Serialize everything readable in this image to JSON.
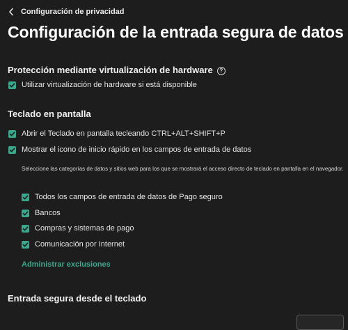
{
  "breadcrumb": {
    "back_label": "Configuración de privacidad"
  },
  "page": {
    "title": "Configuración de la entrada segura de datos"
  },
  "hardware_section": {
    "heading": "Protección mediante virtualización de hardware",
    "help_glyph": "?",
    "option_label": "Utilizar virtualización de hardware si está disponible",
    "option_checked": true
  },
  "keyboard_section": {
    "heading": "Teclado en pantalla",
    "options": [
      {
        "label": "Abrir el Teclado en pantalla tecleando CTRL+ALT+SHIFT+P",
        "checked": true
      },
      {
        "label": "Mostrar el icono de inicio rápido en los campos de entrada de datos",
        "checked": true
      }
    ],
    "description": "Seleccione las categorías de datos y sitios web para los que se mostrará el acceso directo de teclado en pantalla en el navegador.",
    "categories": [
      {
        "label": "Todos los campos de entrada de datos de Pago seguro",
        "checked": true
      },
      {
        "label": "Bancos",
        "checked": true
      },
      {
        "label": "Compras y sistemas de pago",
        "checked": true
      },
      {
        "label": "Comunicación por Internet",
        "checked": true
      }
    ],
    "exclusions_link": "Administrar exclusiones"
  },
  "secure_input_section": {
    "heading": "Entrada segura desde el teclado"
  },
  "colors": {
    "background": "#1d1d1d",
    "accent": "#3aa88c",
    "text": "#e4e4e4"
  }
}
